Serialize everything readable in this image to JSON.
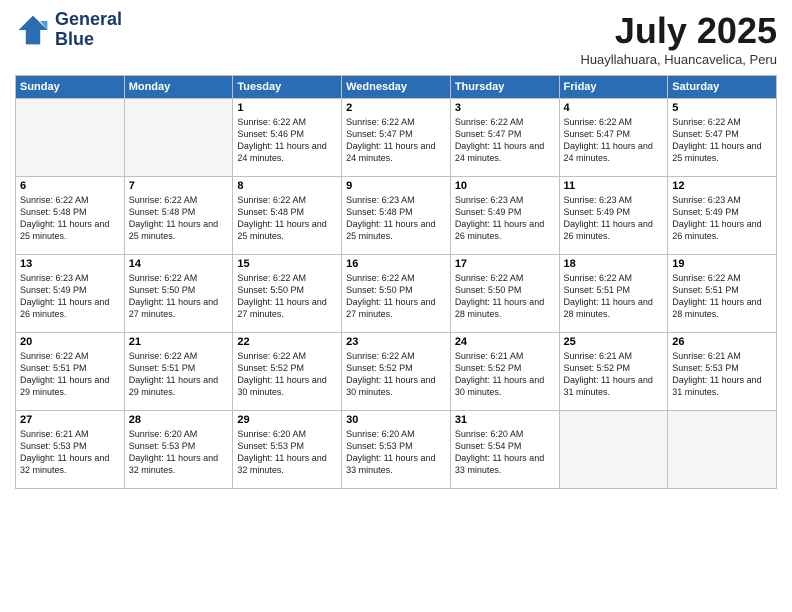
{
  "header": {
    "logo_line1": "General",
    "logo_line2": "Blue",
    "month": "July 2025",
    "location": "Huayllahuara, Huancavelica, Peru"
  },
  "weekdays": [
    "Sunday",
    "Monday",
    "Tuesday",
    "Wednesday",
    "Thursday",
    "Friday",
    "Saturday"
  ],
  "weeks": [
    [
      {
        "day": "",
        "empty": true
      },
      {
        "day": "",
        "empty": true
      },
      {
        "day": "1",
        "sunrise": "6:22 AM",
        "sunset": "5:46 PM",
        "daylight": "11 hours and 24 minutes."
      },
      {
        "day": "2",
        "sunrise": "6:22 AM",
        "sunset": "5:47 PM",
        "daylight": "11 hours and 24 minutes."
      },
      {
        "day": "3",
        "sunrise": "6:22 AM",
        "sunset": "5:47 PM",
        "daylight": "11 hours and 24 minutes."
      },
      {
        "day": "4",
        "sunrise": "6:22 AM",
        "sunset": "5:47 PM",
        "daylight": "11 hours and 24 minutes."
      },
      {
        "day": "5",
        "sunrise": "6:22 AM",
        "sunset": "5:47 PM",
        "daylight": "11 hours and 25 minutes."
      }
    ],
    [
      {
        "day": "6",
        "sunrise": "6:22 AM",
        "sunset": "5:48 PM",
        "daylight": "11 hours and 25 minutes."
      },
      {
        "day": "7",
        "sunrise": "6:22 AM",
        "sunset": "5:48 PM",
        "daylight": "11 hours and 25 minutes."
      },
      {
        "day": "8",
        "sunrise": "6:22 AM",
        "sunset": "5:48 PM",
        "daylight": "11 hours and 25 minutes."
      },
      {
        "day": "9",
        "sunrise": "6:23 AM",
        "sunset": "5:48 PM",
        "daylight": "11 hours and 25 minutes."
      },
      {
        "day": "10",
        "sunrise": "6:23 AM",
        "sunset": "5:49 PM",
        "daylight": "11 hours and 26 minutes."
      },
      {
        "day": "11",
        "sunrise": "6:23 AM",
        "sunset": "5:49 PM",
        "daylight": "11 hours and 26 minutes."
      },
      {
        "day": "12",
        "sunrise": "6:23 AM",
        "sunset": "5:49 PM",
        "daylight": "11 hours and 26 minutes."
      }
    ],
    [
      {
        "day": "13",
        "sunrise": "6:23 AM",
        "sunset": "5:49 PM",
        "daylight": "11 hours and 26 minutes."
      },
      {
        "day": "14",
        "sunrise": "6:22 AM",
        "sunset": "5:50 PM",
        "daylight": "11 hours and 27 minutes."
      },
      {
        "day": "15",
        "sunrise": "6:22 AM",
        "sunset": "5:50 PM",
        "daylight": "11 hours and 27 minutes."
      },
      {
        "day": "16",
        "sunrise": "6:22 AM",
        "sunset": "5:50 PM",
        "daylight": "11 hours and 27 minutes."
      },
      {
        "day": "17",
        "sunrise": "6:22 AM",
        "sunset": "5:50 PM",
        "daylight": "11 hours and 28 minutes."
      },
      {
        "day": "18",
        "sunrise": "6:22 AM",
        "sunset": "5:51 PM",
        "daylight": "11 hours and 28 minutes."
      },
      {
        "day": "19",
        "sunrise": "6:22 AM",
        "sunset": "5:51 PM",
        "daylight": "11 hours and 28 minutes."
      }
    ],
    [
      {
        "day": "20",
        "sunrise": "6:22 AM",
        "sunset": "5:51 PM",
        "daylight": "11 hours and 29 minutes."
      },
      {
        "day": "21",
        "sunrise": "6:22 AM",
        "sunset": "5:51 PM",
        "daylight": "11 hours and 29 minutes."
      },
      {
        "day": "22",
        "sunrise": "6:22 AM",
        "sunset": "5:52 PM",
        "daylight": "11 hours and 30 minutes."
      },
      {
        "day": "23",
        "sunrise": "6:22 AM",
        "sunset": "5:52 PM",
        "daylight": "11 hours and 30 minutes."
      },
      {
        "day": "24",
        "sunrise": "6:21 AM",
        "sunset": "5:52 PM",
        "daylight": "11 hours and 30 minutes."
      },
      {
        "day": "25",
        "sunrise": "6:21 AM",
        "sunset": "5:52 PM",
        "daylight": "11 hours and 31 minutes."
      },
      {
        "day": "26",
        "sunrise": "6:21 AM",
        "sunset": "5:53 PM",
        "daylight": "11 hours and 31 minutes."
      }
    ],
    [
      {
        "day": "27",
        "sunrise": "6:21 AM",
        "sunset": "5:53 PM",
        "daylight": "11 hours and 32 minutes."
      },
      {
        "day": "28",
        "sunrise": "6:20 AM",
        "sunset": "5:53 PM",
        "daylight": "11 hours and 32 minutes."
      },
      {
        "day": "29",
        "sunrise": "6:20 AM",
        "sunset": "5:53 PM",
        "daylight": "11 hours and 32 minutes."
      },
      {
        "day": "30",
        "sunrise": "6:20 AM",
        "sunset": "5:53 PM",
        "daylight": "11 hours and 33 minutes."
      },
      {
        "day": "31",
        "sunrise": "6:20 AM",
        "sunset": "5:54 PM",
        "daylight": "11 hours and 33 minutes."
      },
      {
        "day": "",
        "empty": true
      },
      {
        "day": "",
        "empty": true
      }
    ]
  ]
}
